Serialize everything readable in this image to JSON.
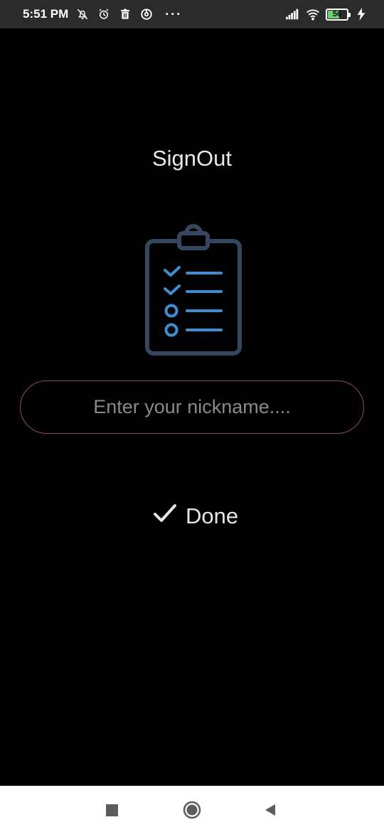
{
  "status_bar": {
    "time": "5:51 PM",
    "left_icons": [
      "notifications-off-icon",
      "alarm-icon",
      "trash-icon",
      "sync-icon"
    ],
    "more": "···",
    "battery_level": "56",
    "battery_fraction": 0.56
  },
  "screen": {
    "title": "SignOut",
    "illustration_icon": "clipboard-checklist-icon",
    "nickname_placeholder": "Enter your nickname....",
    "done_label": "Done",
    "done_icon": "check-icon"
  },
  "navigation": {
    "items": [
      "recent-apps-icon",
      "home-icon",
      "back-icon"
    ]
  },
  "colors": {
    "background": "#000000",
    "status_bar": "#2b2b2b",
    "input_border": "#8a4f5a",
    "clipboard_outline": "#34475e",
    "checklist_accent": "#3f8fd0",
    "battery": "#6bd16b"
  }
}
